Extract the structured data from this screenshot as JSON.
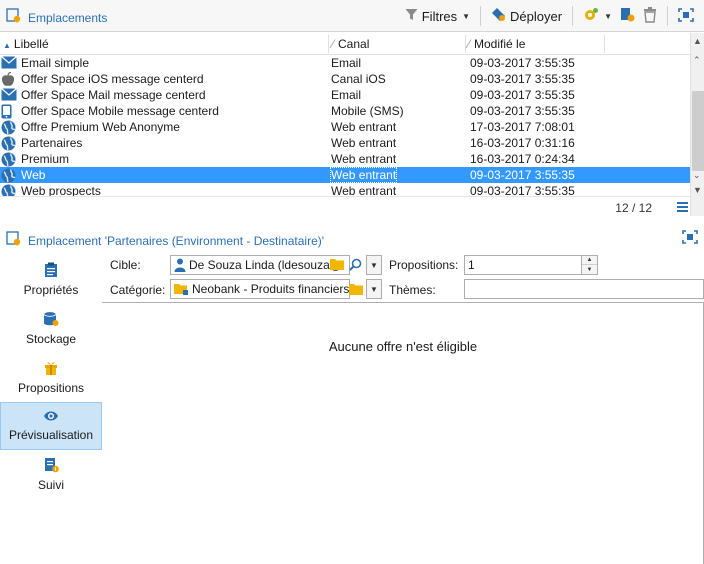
{
  "toolbar": {
    "title": "Emplacements",
    "filters_label": "Filtres",
    "deploy_label": "Déployer"
  },
  "list": {
    "columns": [
      "Libellé",
      "Canal",
      "Modifié le"
    ],
    "rows": [
      {
        "label": "Email simple",
        "canal": "Email",
        "modified": "09-03-2017 3:55:35",
        "icon": "email-icon"
      },
      {
        "label": "Offer Space iOS message centerd",
        "canal": "Canal iOS",
        "modified": "09-03-2017 3:55:35",
        "icon": "apple-icon"
      },
      {
        "label": "Offer Space Mail message centerd",
        "canal": "Email",
        "modified": "09-03-2017 3:55:35",
        "icon": "email-icon"
      },
      {
        "label": "Offer Space Mobile message centerd",
        "canal": "Mobile (SMS)",
        "modified": "09-03-2017 3:55:35",
        "icon": "mobile-icon"
      },
      {
        "label": "Offre Premium Web Anonyme",
        "canal": "Web entrant",
        "modified": "17-03-2017 7:08:01",
        "icon": "globe-icon"
      },
      {
        "label": "Partenaires",
        "canal": "Web entrant",
        "modified": "16-03-2017 0:31:16",
        "icon": "globe-icon"
      },
      {
        "label": "Premium",
        "canal": "Web entrant",
        "modified": "16-03-2017 0:24:34",
        "icon": "globe-icon"
      },
      {
        "label": "Web",
        "canal": "Web entrant",
        "modified": "09-03-2017 3:55:35",
        "icon": "globe-icon",
        "selected": true
      },
      {
        "label": "Web prospects",
        "canal": "Web entrant",
        "modified": "09-03-2017 3:55:35",
        "icon": "globe-icon"
      }
    ],
    "count": "12 / 12"
  },
  "detail": {
    "title": "Emplacement 'Partenaires (Environment - Destinataire)'"
  },
  "nav": {
    "items": [
      {
        "label": "Propriétés",
        "icon": "clipboard-icon"
      },
      {
        "label": "Stockage",
        "icon": "database-icon"
      },
      {
        "label": "Propositions",
        "icon": "gift-icon"
      },
      {
        "label": "Prévisualisation",
        "icon": "eye-icon",
        "active": true
      },
      {
        "label": "Suivi",
        "icon": "tracking-icon"
      }
    ]
  },
  "form": {
    "cible_label": "Cible:",
    "cible_value": "De Souza Linda (ldesouza@",
    "categorie_label": "Catégorie:",
    "categorie_value": "Neobank - Produits financiers",
    "propositions_label": "Propositions:",
    "propositions_value": "1",
    "themes_label": "Thèmes:",
    "themes_value": "",
    "empty_message": "Aucune offre n'est éligible"
  },
  "colors": {
    "accent": "#2b6fb3",
    "selection": "#3399ff",
    "nav_active": "#cce4f7"
  }
}
